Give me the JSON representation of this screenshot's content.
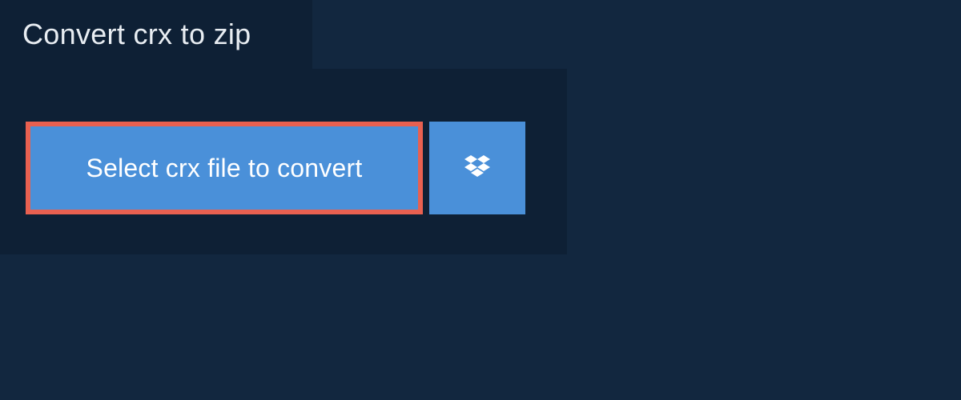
{
  "tab": {
    "label": "Convert crx to zip"
  },
  "actions": {
    "select_file_label": "Select crx file to convert"
  }
}
